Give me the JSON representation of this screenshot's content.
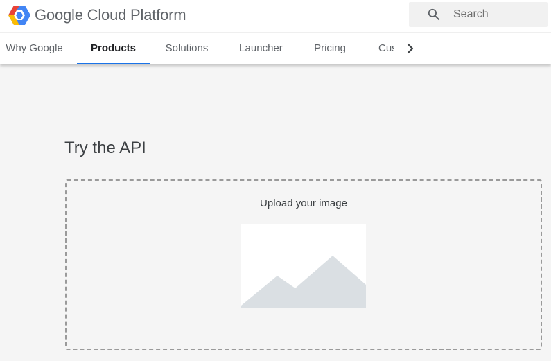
{
  "header": {
    "brand": "Google Cloud Platform",
    "search": {
      "placeholder": "Search"
    }
  },
  "nav": {
    "tabs": [
      {
        "label": "Why Google",
        "active": false
      },
      {
        "label": "Products",
        "active": true
      },
      {
        "label": "Solutions",
        "active": false
      },
      {
        "label": "Launcher",
        "active": false
      },
      {
        "label": "Pricing",
        "active": false
      },
      {
        "label": "Cus",
        "active": false
      }
    ],
    "next_icon": "chevron-right-icon"
  },
  "main": {
    "title": "Try the API",
    "upload": {
      "label": "Upload your image",
      "image_icon": "image-placeholder-icon"
    }
  },
  "colors": {
    "active_tab_underline": "#1a73e8",
    "page_background": "#f5f5f5",
    "placeholder_mountain": "#dadfe3"
  }
}
